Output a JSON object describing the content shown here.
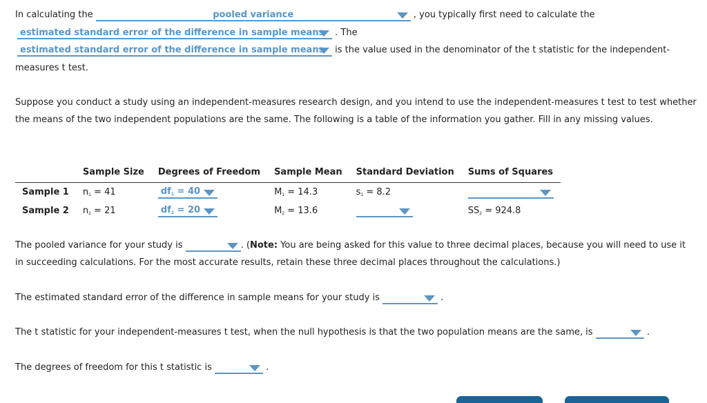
{
  "intro": {
    "text1": "In calculating the",
    "dropdown1": "pooled variance",
    "text2": ", you typically first need to calculate the",
    "dropdown2": "estimated standard error of the difference in sample means",
    "text3": ". The",
    "dropdown3": "estimated standard error of the difference in sample means",
    "text4": "is the value used in the denominator of the t statistic for the independent-",
    "text5": "measures t test."
  },
  "scenario": {
    "line1": "Suppose you conduct a study using an independent-measures research design, and you intend to use the independent-measures t test to test whether",
    "line2": "the means of the two independent populations are the same. The following is a table of the information you gather. Fill in any missing values."
  },
  "table": {
    "headers": [
      "",
      "Sample Size",
      "Degrees of Freedom",
      "Sample Mean",
      "Standard Deviation",
      "Sums of Squares"
    ],
    "rows": [
      {
        "label": "Sample 1",
        "n_prefix": "n",
        "n_sub": "1",
        "n_val": " = 41",
        "df_prefix": "df",
        "df_sub": "1",
        "df_val": " = 40",
        "m_prefix": "M",
        "m_sub": "1",
        "m_val": " = 14.3",
        "s_prefix": "s",
        "s_sub": "1",
        "s_val": " = 8.2",
        "ss_value": ""
      },
      {
        "label": "Sample 2",
        "n_prefix": "n",
        "n_sub": "2",
        "n_val": " = 21",
        "df_prefix": "df",
        "df_sub": "2",
        "df_val": " = 20",
        "m_prefix": "M",
        "m_sub": "2",
        "m_val": " = 13.6",
        "s_value": "",
        "ss_prefix": "SS",
        "ss_sub": "2",
        "ss_val": " = 924.8"
      }
    ]
  },
  "pooled": {
    "text1": "The pooled variance for your study is",
    "value": "",
    "text2": ". (",
    "note_label": "Note:",
    "text3": " You are being asked for this value to three decimal places, because you will need to use it",
    "text4": "in succeeding calculations. For the most accurate results, retain these three decimal places throughout the calculations.)"
  },
  "stderr": {
    "text": "The estimated standard error of the difference in sample means for your study is",
    "value": "",
    "end": "."
  },
  "tstat": {
    "text": "The t statistic for your independent-measures t test, when the null hypothesis is that the two population means are the same, is",
    "value": "",
    "end": "."
  },
  "dof": {
    "text": "The degrees of freedom for this t statistic is",
    "value": "",
    "end": "."
  },
  "colors": {
    "accent": "#5b95c4",
    "button": "#1a6496"
  }
}
